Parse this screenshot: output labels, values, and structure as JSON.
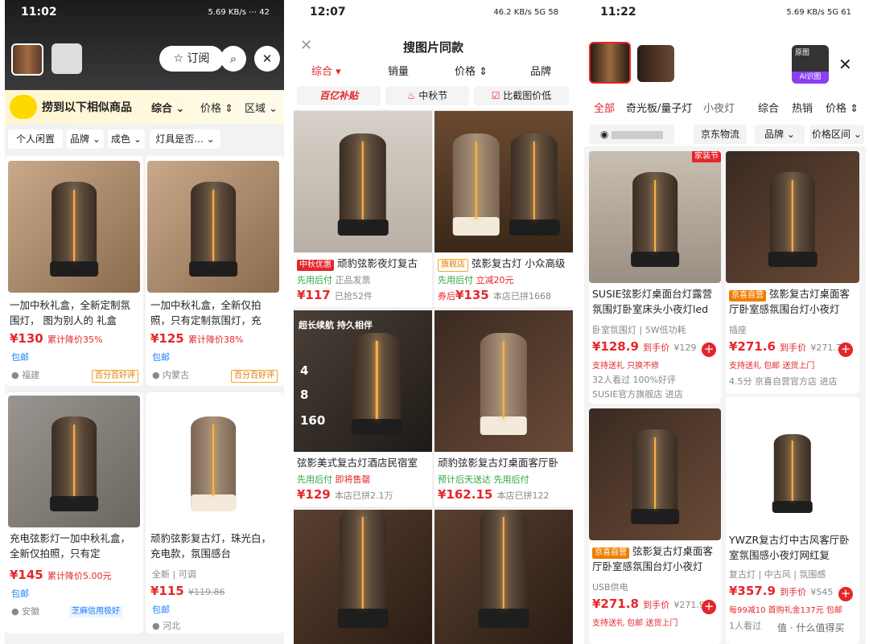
{
  "panel1": {
    "status": {
      "time": "11:02",
      "right": "5.69 KB/s ⋯ 42"
    },
    "subscribe": "订阅",
    "header": "捞到以下相似商品",
    "sort_tabs": [
      "综合",
      "价格",
      "区域"
    ],
    "filters": [
      "个人闲置",
      "品牌",
      "成色",
      "灯具是否..."
    ],
    "items": [
      {
        "title": "一加中秋礼盒，全新定制氛围灯， 图为别人的 礼盒",
        "price": "¥130",
        "drop": "累计降价35%",
        "ship": "包邮",
        "loc": "福建",
        "badge": "百分百好评"
      },
      {
        "title": "一加中秋礼盒，全新仅拍照，只有定制氛围灯，充",
        "price": "¥125",
        "drop": "累计降价38%",
        "ship": "包邮",
        "loc": "内蒙古",
        "badge": "百分百好评"
      },
      {
        "title": "充电弦影灯一加中秋礼盒，全新仅拍照，只有定",
        "price": "¥145",
        "drop": "累计降价5.00元",
        "ship": "包邮",
        "loc": "安徽",
        "badge": "芝麻信用极好"
      },
      {
        "title": "顽豹弦影复古灯，珠光白，充电款，氛围感台",
        "sub": "全新 | 可调",
        "price": "¥115",
        "orig": "¥119.86",
        "ship": "包邮",
        "loc": "河北"
      }
    ]
  },
  "panel2": {
    "status": {
      "time": "12:07",
      "right": "46.2 KB/s 5G 58"
    },
    "title": "搜图片同款",
    "tabs": [
      "综合",
      "销量",
      "价格",
      "品牌"
    ],
    "promos": [
      "百亿补贴",
      "中秋节",
      "比截图价低"
    ],
    "items": [
      {
        "tag": "中秋优惠",
        "title": "顽豹弦影夜灯复古",
        "line2a": "先用后付",
        "line2b": "正品发票",
        "price": "¥117",
        "meta": "已抢52件"
      },
      {
        "tag": "旗舰店",
        "title": "弦影复古灯 小众高级",
        "line2a": "先用后付",
        "line2b": "立减20元",
        "pre": "券后",
        "price": "¥135",
        "meta": "本店已拼1668"
      },
      {
        "title": "弦影美式复古灯酒店民宿室",
        "line2a": "先用后付",
        "line2b": "即将售罄",
        "price": "¥129",
        "meta": "本店已拼2.1万",
        "overlay": [
          "超长续航 持久相伴",
          "4",
          "8",
          "160"
        ]
      },
      {
        "title": "顽豹弦影复古灯桌面客厅卧",
        "line2a": "预计后天送达",
        "line2b": "先用后付",
        "price": "¥162.15",
        "meta": "本店已拼122"
      }
    ]
  },
  "panel3": {
    "status": {
      "time": "11:22",
      "right": "5.69 KB/s 5G 61"
    },
    "orig_label": "原图",
    "ai_label": "AI识图",
    "cats": [
      "全部",
      "奇光板/量子灯",
      "小夜灯",
      "综合",
      "热销",
      "价格"
    ],
    "filters": [
      "京东物流",
      "品牌",
      "价格区间"
    ],
    "items": [
      {
        "badge": "家装节",
        "title": "SUSIE弦影灯桌面台灯露营氛围灯卧室床头小夜灯led",
        "attr": "卧室氛围灯 | 5W低功耗",
        "price": "¥128.9",
        "label": "到手价",
        "orig": "¥129",
        "tags": [
          "支持送礼",
          "只换不修"
        ],
        "stat": "32人看过 100%好评",
        "shop": "SUSIE官方旗舰店 进店"
      },
      {
        "self": "京喜自营",
        "title": "弦影复古灯桌面客厅卧室感氛围台灯小夜灯",
        "attr": "插座",
        "price": "¥271.6",
        "label": "到手价",
        "orig": "¥271.7",
        "tags": [
          "支持送礼",
          "包邮",
          "送货上门"
        ],
        "stat": "4.5分 京喜自营官方店 进店"
      },
      {
        "self": "京喜自营",
        "title": "弦影复古灯桌面客厅卧室感氛围台灯小夜灯",
        "attr": "USB供电",
        "price": "¥271.8",
        "label": "到手价",
        "orig": "¥271.9",
        "tags": [
          "支持送礼",
          "包邮",
          "送货上门"
        ]
      },
      {
        "title": "YWZR复古灯中古风客厅卧室氛围感小夜灯网红复",
        "attr": "复古灯 | 中古风 | 氛围感",
        "price": "¥357.9",
        "label": "到手价",
        "orig": "¥545",
        "tags": [
          "每99减10",
          "首购礼金137元",
          "包邮"
        ],
        "stat": "1人看过"
      }
    ],
    "watermark": "值 · 什么值得买"
  }
}
